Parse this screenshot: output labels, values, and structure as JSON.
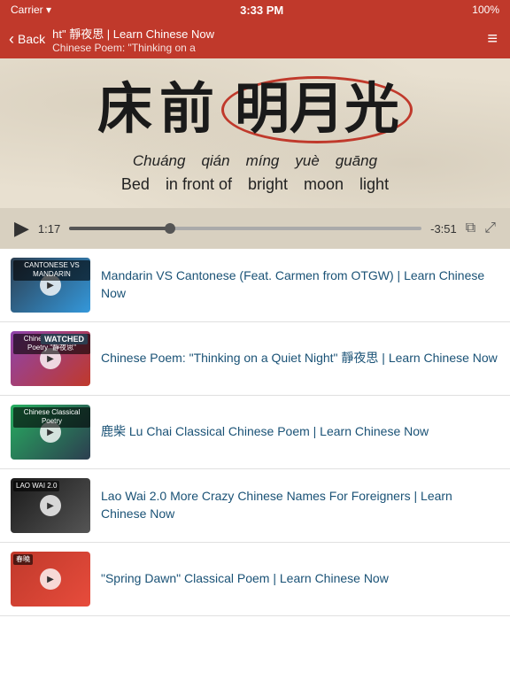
{
  "statusBar": {
    "carrier": "Carrier ▾",
    "time": "3:33 PM",
    "battery": "100%"
  },
  "navBar": {
    "backLabel": "Back",
    "title": "ht\" 靜夜思 | Learn Chinese Now",
    "subtitle": "Chinese Poem: \"Thinking on a",
    "menuIcon": "≡"
  },
  "hero": {
    "chineseChars": [
      "床",
      "前",
      "明",
      "月",
      "光"
    ],
    "highlightedChars": [
      2,
      3,
      4
    ],
    "pinyinWords": [
      "Chuáng",
      "qián",
      "míng",
      "yuè",
      "guāng"
    ],
    "englishWords": [
      "Bed",
      "in front of",
      "bright",
      "moon",
      "light"
    ]
  },
  "audioPlayer": {
    "playIcon": "▶",
    "currentTime": "1:17",
    "progressPercent": 28,
    "remainingTime": "-3:51",
    "pipIcon": "⧉",
    "expandIcon": "⤢"
  },
  "videoList": [
    {
      "id": 1,
      "thumbClass": "thumb-1",
      "thumbLabel": "CANTONESE\nVS\nMANDARIN",
      "watched": false,
      "title": "Mandarin VS Cantonese (Feat. Carmen from OTGW) | Learn Chinese Now"
    },
    {
      "id": 2,
      "thumbClass": "thumb-2",
      "thumbLabel": "Chinese Classical\nPoetry\n\"靜夜思\"",
      "watched": true,
      "title": "Chinese Poem: \"Thinking on a Quiet Night\" 靜夜思 | Learn Chinese Now"
    },
    {
      "id": 3,
      "thumbClass": "thumb-3",
      "thumbLabel": "Chinese\nClassical Poetry",
      "watched": false,
      "title": "鹿柴 Lu Chai Classical Chinese Poem | Learn Chinese Now"
    },
    {
      "id": 4,
      "thumbClass": "thumb-4",
      "thumbLabel": "LAO\nWAI\n2.0",
      "watched": false,
      "title": "Lao Wai 2.0 More Crazy Chinese Names For Foreigners | Learn Chinese Now"
    },
    {
      "id": 5,
      "thumbClass": "thumb-5",
      "thumbLabel": "春曉",
      "watched": false,
      "title": "\"Spring Dawn\" Classical Poem | Learn Chinese Now"
    }
  ],
  "labels": {
    "watched": "WATCHED"
  }
}
